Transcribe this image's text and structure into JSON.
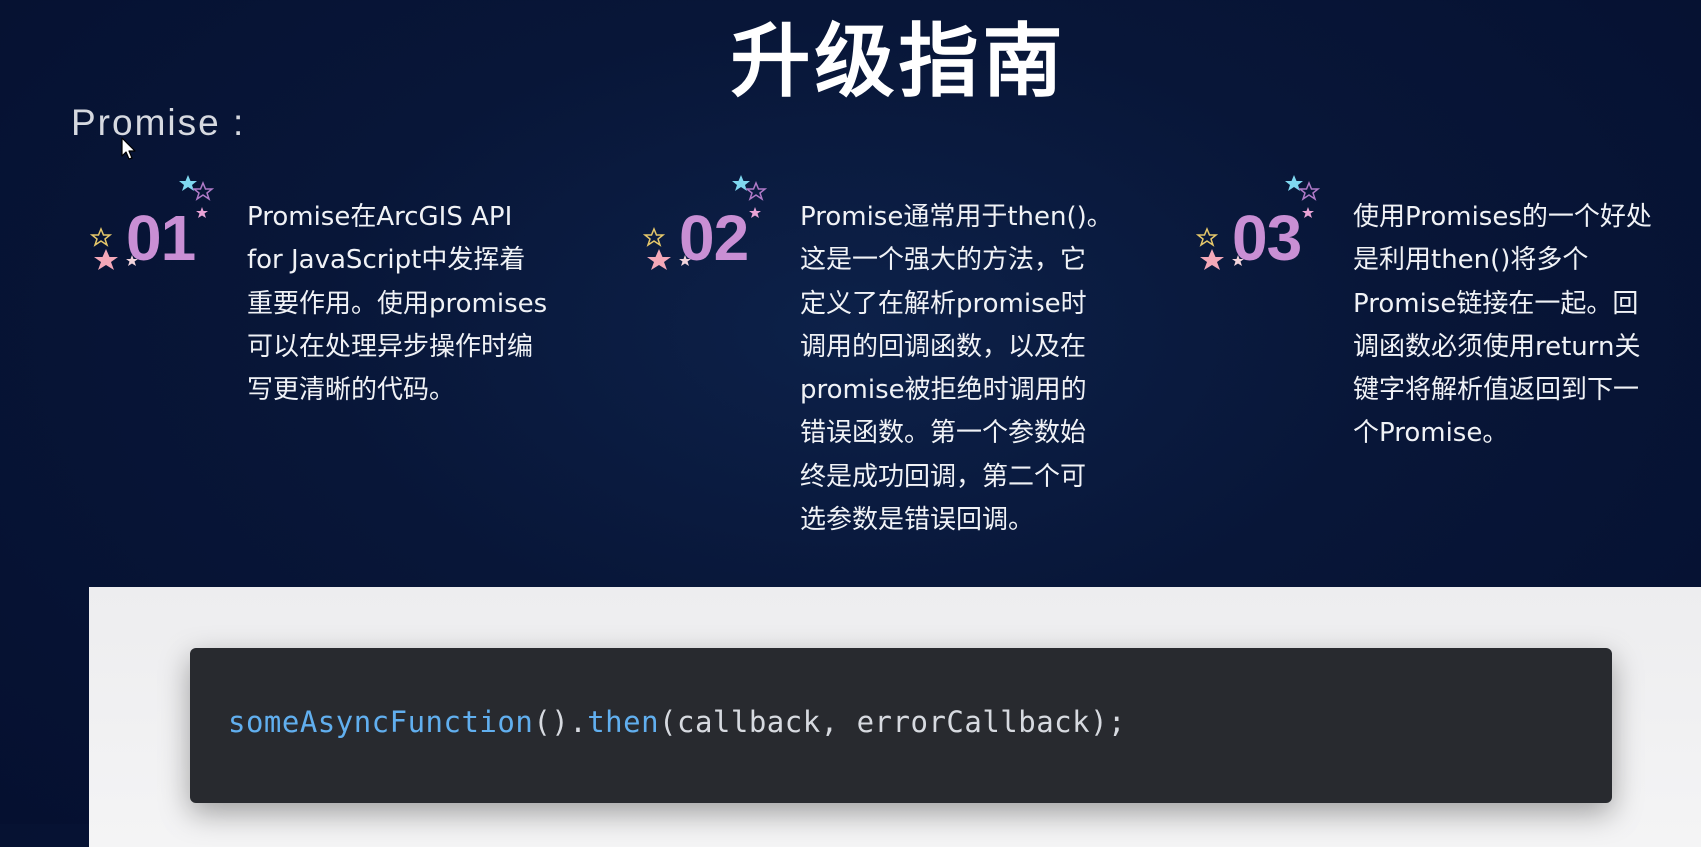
{
  "slide": {
    "title": "升级指南",
    "section_label": "Promise :"
  },
  "items": [
    {
      "number": "01",
      "text": "Promise在ArcGIS API\nfor JavaScript中发挥着\n重要作用。使用promises\n可以在处理异步操作时编\n写更清晰的代码。"
    },
    {
      "number": "02",
      "text": "Promise通常用于then()。\n这是一个强大的方法，它\n定义了在解析promise时\n调用的回调函数，以及在\npromise被拒绝时调用的\n错误函数。第一个参数始\n终是成功回调，第二个可\n选参数是错误回调。"
    },
    {
      "number": "03",
      "text": "使用Promises的一个好处\n是利用then()将多个\nPromise链接在一起。回\n调函数必须使用return关\n键字将解析值返回到下一\n个Promise。"
    }
  ],
  "code": {
    "fn_name": "someAsyncFunction",
    "call_parens": "().",
    "method": "then",
    "args": "(callback, errorCallback);"
  },
  "colors": {
    "background": "#081638",
    "number_accent": "#c98fd4",
    "code_background": "#282a2f",
    "code_keyword": "#61afef",
    "code_text": "#d7dae0"
  },
  "icons": {
    "cursor": "mouse-pointer-icon",
    "decoration": "stars-decoration-icon"
  }
}
